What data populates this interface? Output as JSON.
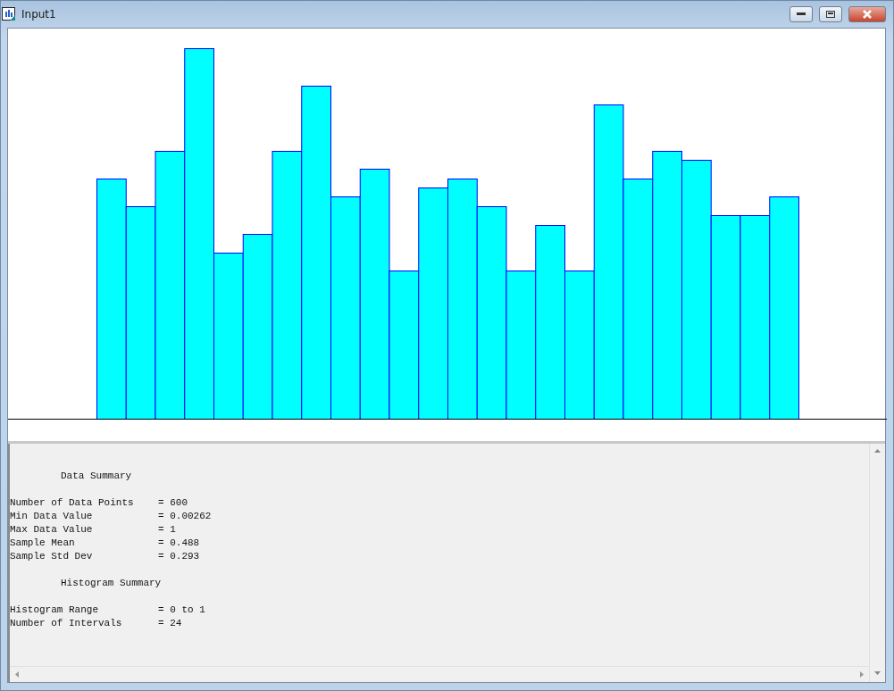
{
  "window": {
    "title": "Input1"
  },
  "summary": [
    {
      "kind": "heading",
      "text": "Data Summary"
    },
    {
      "kind": "row",
      "label": "Number of Data Points",
      "value": "= 600"
    },
    {
      "kind": "row",
      "label": "Min Data Value",
      "value": "= 0.00262"
    },
    {
      "kind": "row",
      "label": "Max Data Value",
      "value": "= 1"
    },
    {
      "kind": "row",
      "label": "Sample Mean",
      "value": "= 0.488"
    },
    {
      "kind": "row",
      "label": "Sample Std Dev",
      "value": "= 0.293"
    },
    {
      "kind": "heading",
      "text": "Histogram Summary"
    },
    {
      "kind": "row",
      "label": "Histogram Range",
      "value": "= 0 to 1"
    },
    {
      "kind": "row",
      "label": "Number of Intervals",
      "value": "= 24"
    }
  ]
}
